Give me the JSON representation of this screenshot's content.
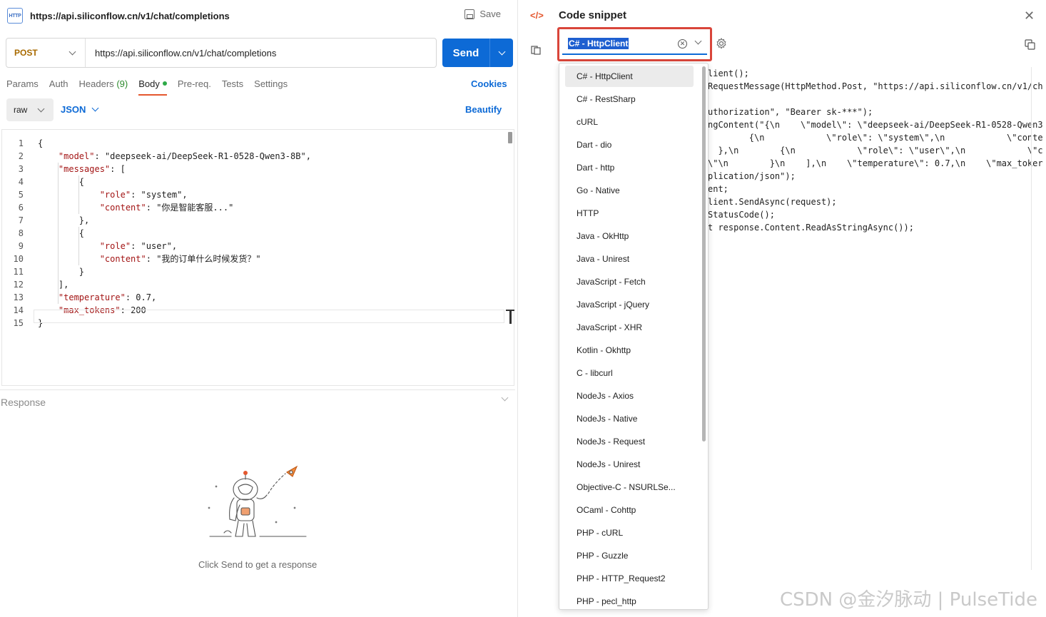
{
  "request": {
    "protocol_badge": "HTTP",
    "title": "https://api.siliconflow.cn/v1/chat/completions",
    "save_label": "Save",
    "method": "POST",
    "url": "https://api.siliconflow.cn/v1/chat/completions",
    "send_label": "Send"
  },
  "tabs": [
    {
      "label": "Params"
    },
    {
      "label": "Auth"
    },
    {
      "label": "Headers",
      "count": "(9)"
    },
    {
      "label": "Body",
      "active": true
    },
    {
      "label": "Pre-req."
    },
    {
      "label": "Tests"
    },
    {
      "label": "Settings"
    }
  ],
  "cookies_label": "Cookies",
  "body": {
    "mode": "raw",
    "language": "JSON",
    "beautify_label": "Beautify",
    "line_numbers": [
      "1",
      "2",
      "3",
      "4",
      "5",
      "6",
      "7",
      "8",
      "9",
      "10",
      "11",
      "12",
      "13",
      "14",
      "15"
    ],
    "lines": [
      "{",
      "    \"model\": \"deepseek-ai/DeepSeek-R1-0528-Qwen3-8B\",",
      "    \"messages\": [",
      "        {",
      "            \"role\": \"system\",",
      "            \"content\": \"你是智能客服...\"",
      "        },",
      "        {",
      "            \"role\": \"user\",",
      "            \"content\": \"我的订单什么时候发货？\"",
      "        }",
      "    ],",
      "    \"temperature\": 0.7,",
      "    \"max_tokens\": 200",
      "}"
    ]
  },
  "response": {
    "label": "Response",
    "empty_hint": "Click Send to get a response"
  },
  "snippet": {
    "title": "Code snippet",
    "selected_language": "C# - HttpClient",
    "code_lines": [
      "lient();",
      "RequestMessage(HttpMethod.Post, \"https://api.siliconflow.cn/v1/ch",
      "",
      "uthorization\", \"Bearer sk-***\");",
      "ngContent(\"{\\n    \\\"model\\\": \\\"deepseek-ai/DeepSeek-R1-0528-Qwen3",
      "        {\\n            \\\"role\\\": \\\"system\\\",\\n            \\\"conten",
      "  },\\n        {\\n            \\\"role\\\": \\\"user\\\",\\n            \\\"c",
      "\\\"\\n        }\\n    ],\\n    \\\"temperature\\\": 0.7,\\n    \\\"max_toker",
      "plication/json\");",
      "ent;",
      "lient.SendAsync(request);",
      "StatusCode();",
      "t response.Content.ReadAsStringAsync());"
    ],
    "languages": [
      "C# - HttpClient",
      "C# - RestSharp",
      "cURL",
      "Dart - dio",
      "Dart - http",
      "Go - Native",
      "HTTP",
      "Java - OkHttp",
      "Java - Unirest",
      "JavaScript - Fetch",
      "JavaScript - jQuery",
      "JavaScript - XHR",
      "Kotlin - Okhttp",
      "C - libcurl",
      "NodeJs - Axios",
      "NodeJs - Native",
      "NodeJs - Request",
      "NodeJs - Unirest",
      "Objective-C - NSURLSe...",
      "OCaml - Cohttp",
      "PHP - cURL",
      "PHP - Guzzle",
      "PHP - HTTP_Request2",
      "PHP - pecl_http"
    ]
  },
  "watermark": "CSDN @金汐脉动 | PulseTide",
  "colors": {
    "accent": "#0d6ad6",
    "method": "#a86a00",
    "highlight_border": "#d9453a",
    "active_tab_underline": "#e4572e",
    "json_key": "#a31515",
    "json_string": "#0451a5",
    "json_number": "#098658"
  }
}
